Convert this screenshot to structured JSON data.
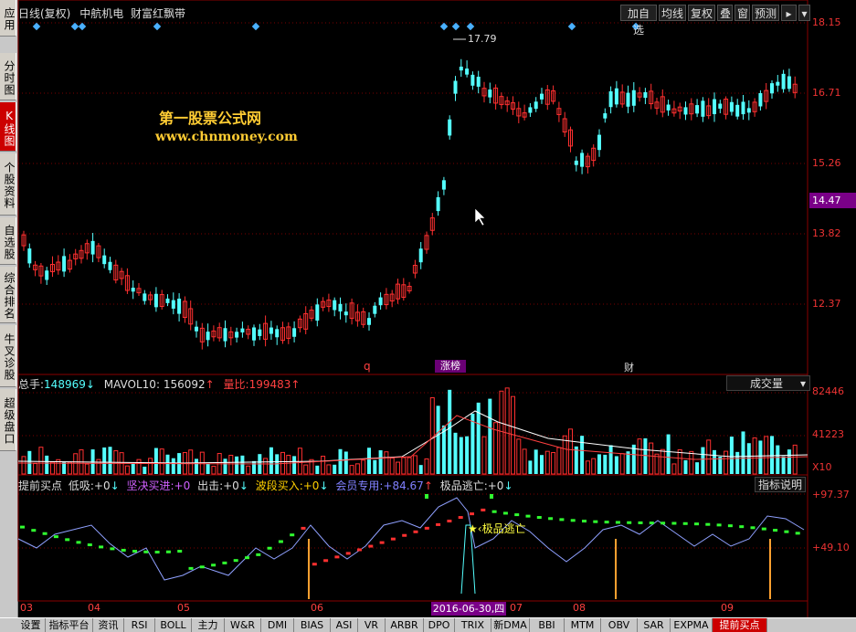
{
  "header": {
    "period": "日线(复权)",
    "stock_name": "中航机电",
    "indicator_name": "财富红飘带"
  },
  "toolbar": [
    "加自选",
    "均线",
    "复权",
    "叠",
    "窗",
    "预测"
  ],
  "left_tabs": [
    {
      "label": "应用",
      "active": false
    },
    {
      "label": "分时图",
      "active": false
    },
    {
      "label": "K线图",
      "active": true
    },
    {
      "label": "个股资料",
      "active": false
    },
    {
      "label": "自选股",
      "active": false
    },
    {
      "label": "综合排名",
      "active": false
    },
    {
      "label": "牛叉诊股",
      "active": false
    },
    {
      "label": "超级盘口",
      "active": false
    }
  ],
  "watermark": {
    "line1": "第一股票公式网",
    "line2": "www.chnmoney.com"
  },
  "price_axis": [
    "18.15",
    "16.71",
    "15.26",
    "13.82",
    "12.37"
  ],
  "current_price": "14.47",
  "high_marker": "17.79",
  "event_markers": {
    "q": "q",
    "zhangbang": "涨榜",
    "cai": "财"
  },
  "volume_bar": {
    "total_label": "总手:",
    "total_value": "148969",
    "mavol_label": "MAVOL10:",
    "mavol_value": "156092",
    "ratio_label": "量比:",
    "ratio_value": "199483",
    "dropdown": "成交量"
  },
  "volume_axis": [
    "82446",
    "41223",
    "X10"
  ],
  "indicator_bar": {
    "name": "提前买点",
    "items": [
      {
        "label": "低吸:",
        "value": "+0"
      },
      {
        "label": "坚决买进:",
        "value": "+0"
      },
      {
        "label": "出击:",
        "value": "+0"
      },
      {
        "label": "波段买入:",
        "value": "+0"
      },
      {
        "label": "会员专用:",
        "value": "+84.67"
      },
      {
        "label": "极品逃亡:",
        "value": "+0"
      }
    ],
    "help_button": "指标说明"
  },
  "indicator_axis": [
    "+97.37",
    "+49.10"
  ],
  "escape_annotation": "极品逃亡",
  "date_axis": {
    "months": [
      "03",
      "04",
      "05",
      "06",
      "07",
      "08",
      "09"
    ],
    "cursor_date": "2016-06-30,四"
  },
  "bottom_tabs": [
    {
      "label": "设置",
      "active": false
    },
    {
      "label": "指标平台",
      "active": false
    },
    {
      "label": "资讯",
      "active": false
    },
    {
      "label": "RSI",
      "active": false
    },
    {
      "label": "BOLL",
      "active": false
    },
    {
      "label": "主力",
      "active": false
    },
    {
      "label": "W&R",
      "active": false
    },
    {
      "label": "DMI",
      "active": false
    },
    {
      "label": "BIAS",
      "active": false
    },
    {
      "label": "ASI",
      "active": false
    },
    {
      "label": "VR",
      "active": false
    },
    {
      "label": "ARBR",
      "active": false
    },
    {
      "label": "DPO",
      "active": false
    },
    {
      "label": "TRIX",
      "active": false
    },
    {
      "label": "新DMA",
      "active": false
    },
    {
      "label": "BBI",
      "active": false
    },
    {
      "label": "MTM",
      "active": false
    },
    {
      "label": "OBV",
      "active": false
    },
    {
      "label": "SAR",
      "active": false
    },
    {
      "label": "EXPMA",
      "active": false
    },
    {
      "label": "提前买点",
      "active": true
    }
  ],
  "colors": {
    "up": "#ff3030",
    "down": "#54ffff",
    "grid": "#7a0000",
    "axis_text": "#ff4040",
    "watermark": "#ffcc33",
    "highlight": "#7a0088"
  }
}
